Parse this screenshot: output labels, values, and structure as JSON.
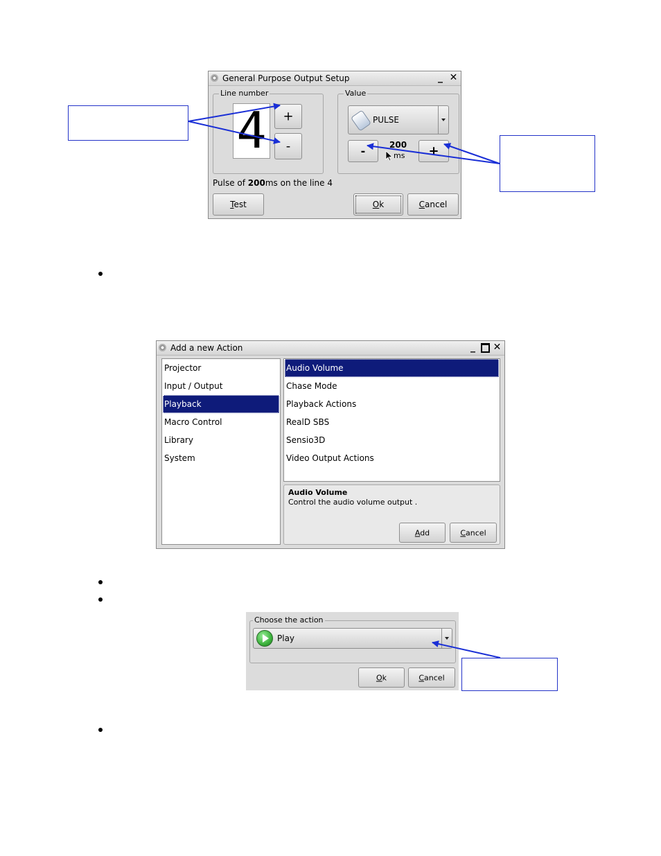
{
  "gpo_dialog": {
    "title": "General Purpose Output Setup",
    "line_group_label": "Line number",
    "line_digit": "4",
    "plus_label": "+",
    "minus_label": "-",
    "value_group_label": "Value",
    "mode_value": "PULSE",
    "duration_value": "200",
    "duration_unit": "ms",
    "status_text_pre": "Pulse of ",
    "status_text_bold": "200",
    "status_text_post": "ms on the line 4",
    "test_label_u": "T",
    "test_label_rest": "est",
    "ok_label_u": "O",
    "ok_label_rest": "k",
    "cancel_label_u": "C",
    "cancel_label_rest": "ancel"
  },
  "action_dialog": {
    "title": "Add a new Action",
    "categories": [
      "Projector",
      "Input / Output",
      "Playback",
      "Macro Control",
      "Library",
      "System"
    ],
    "selected_category": "Playback",
    "actions": [
      "Audio Volume",
      "Chase Mode",
      "Playback Actions",
      "RealD SBS",
      "Sensio3D",
      "Video Output Actions"
    ],
    "selected_action": "Audio Volume",
    "desc_title": "Audio Volume",
    "desc_text": "Control the audio volume output .",
    "add_label_u": "A",
    "add_label_rest": "dd",
    "cancel_label_u": "C",
    "cancel_label_rest": "ancel"
  },
  "choose_dialog": {
    "group_label": "Choose the action",
    "selected_value": "Play",
    "ok_label_u": "O",
    "ok_label_rest": "k",
    "cancel_label_u": "C",
    "cancel_label_rest": "ancel"
  },
  "colors": {
    "selection": "#0e1b7a",
    "callout_border": "#2333c8",
    "arrow": "#1a2fd6",
    "play_icon": "#3bb13b"
  }
}
